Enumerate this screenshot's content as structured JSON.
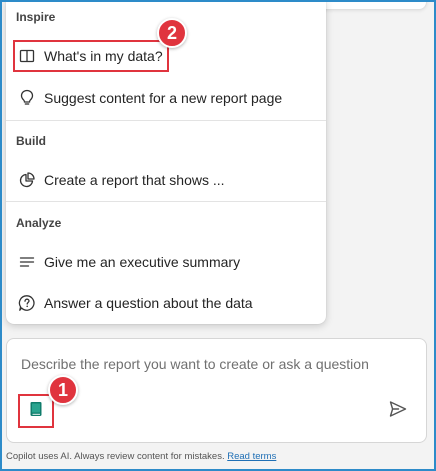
{
  "menu": {
    "sections": [
      {
        "title": "Inspire",
        "items": [
          {
            "label": "What's in my data?",
            "icon": "book-open-icon"
          },
          {
            "label": "Suggest content for a new report page",
            "icon": "lightbulb-icon"
          }
        ]
      },
      {
        "title": "Build",
        "items": [
          {
            "label": "Create a report that shows ...",
            "icon": "pie-chart-icon"
          }
        ]
      },
      {
        "title": "Analyze",
        "items": [
          {
            "label": "Give me an executive summary",
            "icon": "text-lines-icon"
          },
          {
            "label": "Answer a question about the data",
            "icon": "question-bubble-icon"
          }
        ]
      }
    ]
  },
  "chat": {
    "placeholder": "Describe the report you want to create or ask a question"
  },
  "footer": {
    "text": "Copilot uses AI. Always review content for mistakes.",
    "link": "Read terms"
  },
  "annotations": {
    "badge_1": "1",
    "badge_2": "2"
  },
  "colors": {
    "highlight": "#e0343e",
    "accent_teal": "#107c6b",
    "frame": "#2d8bc9"
  }
}
